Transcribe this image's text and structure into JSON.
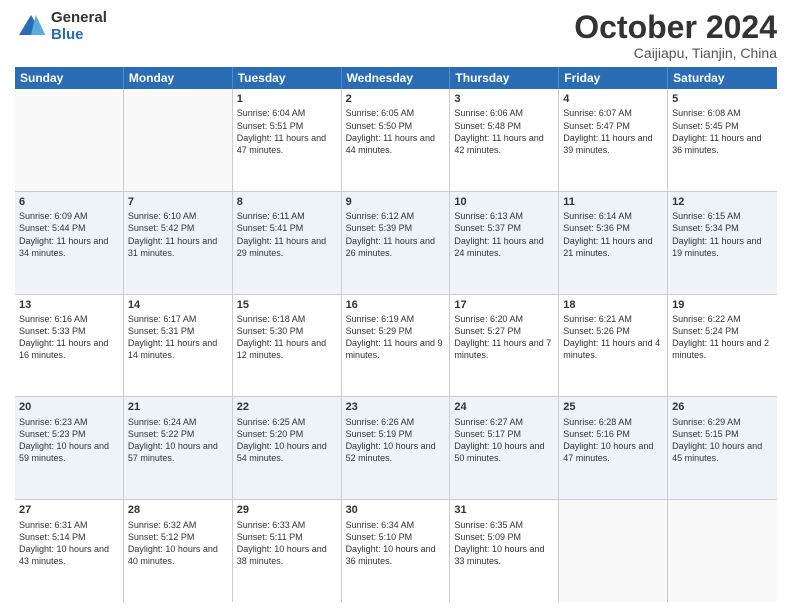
{
  "logo": {
    "general": "General",
    "blue": "Blue"
  },
  "title": "October 2024",
  "subtitle": "Caijiapu, Tianjin, China",
  "weekdays": [
    "Sunday",
    "Monday",
    "Tuesday",
    "Wednesday",
    "Thursday",
    "Friday",
    "Saturday"
  ],
  "rows": [
    [
      {
        "day": "",
        "text": "",
        "empty": true
      },
      {
        "day": "",
        "text": "",
        "empty": true
      },
      {
        "day": "1",
        "text": "Sunrise: 6:04 AM\nSunset: 5:51 PM\nDaylight: 11 hours and 47 minutes.",
        "empty": false
      },
      {
        "day": "2",
        "text": "Sunrise: 6:05 AM\nSunset: 5:50 PM\nDaylight: 11 hours and 44 minutes.",
        "empty": false
      },
      {
        "day": "3",
        "text": "Sunrise: 6:06 AM\nSunset: 5:48 PM\nDaylight: 11 hours and 42 minutes.",
        "empty": false
      },
      {
        "day": "4",
        "text": "Sunrise: 6:07 AM\nSunset: 5:47 PM\nDaylight: 11 hours and 39 minutes.",
        "empty": false
      },
      {
        "day": "5",
        "text": "Sunrise: 6:08 AM\nSunset: 5:45 PM\nDaylight: 11 hours and 36 minutes.",
        "empty": false
      }
    ],
    [
      {
        "day": "6",
        "text": "Sunrise: 6:09 AM\nSunset: 5:44 PM\nDaylight: 11 hours and 34 minutes.",
        "empty": false
      },
      {
        "day": "7",
        "text": "Sunrise: 6:10 AM\nSunset: 5:42 PM\nDaylight: 11 hours and 31 minutes.",
        "empty": false
      },
      {
        "day": "8",
        "text": "Sunrise: 6:11 AM\nSunset: 5:41 PM\nDaylight: 11 hours and 29 minutes.",
        "empty": false
      },
      {
        "day": "9",
        "text": "Sunrise: 6:12 AM\nSunset: 5:39 PM\nDaylight: 11 hours and 26 minutes.",
        "empty": false
      },
      {
        "day": "10",
        "text": "Sunrise: 6:13 AM\nSunset: 5:37 PM\nDaylight: 11 hours and 24 minutes.",
        "empty": false
      },
      {
        "day": "11",
        "text": "Sunrise: 6:14 AM\nSunset: 5:36 PM\nDaylight: 11 hours and 21 minutes.",
        "empty": false
      },
      {
        "day": "12",
        "text": "Sunrise: 6:15 AM\nSunset: 5:34 PM\nDaylight: 11 hours and 19 minutes.",
        "empty": false
      }
    ],
    [
      {
        "day": "13",
        "text": "Sunrise: 6:16 AM\nSunset: 5:33 PM\nDaylight: 11 hours and 16 minutes.",
        "empty": false
      },
      {
        "day": "14",
        "text": "Sunrise: 6:17 AM\nSunset: 5:31 PM\nDaylight: 11 hours and 14 minutes.",
        "empty": false
      },
      {
        "day": "15",
        "text": "Sunrise: 6:18 AM\nSunset: 5:30 PM\nDaylight: 11 hours and 12 minutes.",
        "empty": false
      },
      {
        "day": "16",
        "text": "Sunrise: 6:19 AM\nSunset: 5:29 PM\nDaylight: 11 hours and 9 minutes.",
        "empty": false
      },
      {
        "day": "17",
        "text": "Sunrise: 6:20 AM\nSunset: 5:27 PM\nDaylight: 11 hours and 7 minutes.",
        "empty": false
      },
      {
        "day": "18",
        "text": "Sunrise: 6:21 AM\nSunset: 5:26 PM\nDaylight: 11 hours and 4 minutes.",
        "empty": false
      },
      {
        "day": "19",
        "text": "Sunrise: 6:22 AM\nSunset: 5:24 PM\nDaylight: 11 hours and 2 minutes.",
        "empty": false
      }
    ],
    [
      {
        "day": "20",
        "text": "Sunrise: 6:23 AM\nSunset: 5:23 PM\nDaylight: 10 hours and 59 minutes.",
        "empty": false
      },
      {
        "day": "21",
        "text": "Sunrise: 6:24 AM\nSunset: 5:22 PM\nDaylight: 10 hours and 57 minutes.",
        "empty": false
      },
      {
        "day": "22",
        "text": "Sunrise: 6:25 AM\nSunset: 5:20 PM\nDaylight: 10 hours and 54 minutes.",
        "empty": false
      },
      {
        "day": "23",
        "text": "Sunrise: 6:26 AM\nSunset: 5:19 PM\nDaylight: 10 hours and 52 minutes.",
        "empty": false
      },
      {
        "day": "24",
        "text": "Sunrise: 6:27 AM\nSunset: 5:17 PM\nDaylight: 10 hours and 50 minutes.",
        "empty": false
      },
      {
        "day": "25",
        "text": "Sunrise: 6:28 AM\nSunset: 5:16 PM\nDaylight: 10 hours and 47 minutes.",
        "empty": false
      },
      {
        "day": "26",
        "text": "Sunrise: 6:29 AM\nSunset: 5:15 PM\nDaylight: 10 hours and 45 minutes.",
        "empty": false
      }
    ],
    [
      {
        "day": "27",
        "text": "Sunrise: 6:31 AM\nSunset: 5:14 PM\nDaylight: 10 hours and 43 minutes.",
        "empty": false
      },
      {
        "day": "28",
        "text": "Sunrise: 6:32 AM\nSunset: 5:12 PM\nDaylight: 10 hours and 40 minutes.",
        "empty": false
      },
      {
        "day": "29",
        "text": "Sunrise: 6:33 AM\nSunset: 5:11 PM\nDaylight: 10 hours and 38 minutes.",
        "empty": false
      },
      {
        "day": "30",
        "text": "Sunrise: 6:34 AM\nSunset: 5:10 PM\nDaylight: 10 hours and 36 minutes.",
        "empty": false
      },
      {
        "day": "31",
        "text": "Sunrise: 6:35 AM\nSunset: 5:09 PM\nDaylight: 10 hours and 33 minutes.",
        "empty": false
      },
      {
        "day": "",
        "text": "",
        "empty": true
      },
      {
        "day": "",
        "text": "",
        "empty": true
      }
    ]
  ]
}
